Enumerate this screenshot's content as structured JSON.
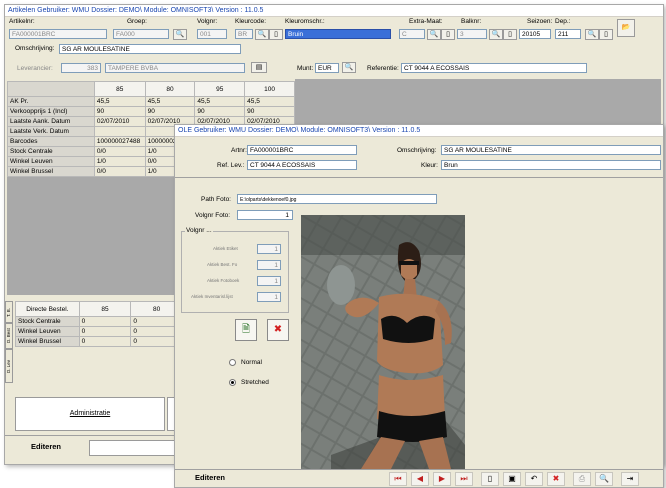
{
  "back": {
    "title": "Artikelen  Gebruiker: WMU  Dossier: DEMO\\  Module: OMNISOFT3\\  Version : 11.0.5",
    "labels": {
      "artikelnr": "Artikelnr:",
      "groep": "Groep:",
      "volgnr": "Volgnr:",
      "kleurcode": "Kleurcode:",
      "kleuromschr": "Kleuromschr.:",
      "extra_maat": "Extra-Maat:",
      "balknr": "Balknr:",
      "seizoen": "Seizoen:",
      "dep": "Dep.:",
      "omschrijving": "Omschrijving:",
      "leverancier": "Leverancier:",
      "munt": "Munt:",
      "referentie": "Referentie:"
    },
    "values": {
      "artikelnr": "FA000001BRC",
      "groep": "FA000",
      "volgnr": "001",
      "kleurcode": "BR",
      "kleuromschr": "Bruin",
      "extra_maat": "C",
      "balknr": "3",
      "seizoen": "20105",
      "dep": "211",
      "omschrijving": "SG AR MOULESATINE",
      "leverancier_code": "383",
      "leverancier_name": "TAMPERE BVBA",
      "munt": "EUR",
      "referentie": "CT 9044 A ECOSSAIS"
    },
    "grid": {
      "columns": [
        "85",
        "80",
        "95",
        "100"
      ],
      "rows": [
        {
          "label": "AK Pr.",
          "cells": [
            "45,5",
            "45,5",
            "45,5",
            "45,5"
          ]
        },
        {
          "label": "Verkoopprijs 1 (Incl)",
          "cells": [
            "90",
            "90",
            "90",
            "90"
          ]
        },
        {
          "label": "Laatste Aank. Datum",
          "cells": [
            "02/07/2010",
            "02/07/2010",
            "02/07/2010",
            "02/07/2010"
          ]
        },
        {
          "label": "Laatste Verk. Datum",
          "cells": [
            "",
            "",
            "",
            ""
          ]
        },
        {
          "label": "Barcodes",
          "cells": [
            "100000027488",
            "10000002",
            "",
            ""
          ]
        },
        {
          "label": "Stock Centrale",
          "cells": [
            "0/0",
            "1/0",
            "",
            ""
          ]
        },
        {
          "label": "Winkel Leuven",
          "cells": [
            "1/0",
            "0/0",
            "",
            ""
          ]
        },
        {
          "label": "Winkel Brussel",
          "cells": [
            "0/0",
            "1/0",
            "",
            ""
          ]
        }
      ]
    },
    "lower_grid": {
      "columns": [
        "Directe Bestel.",
        "85",
        "80"
      ],
      "rows": [
        {
          "label": "Stock Centrale",
          "cells": [
            "0",
            "0"
          ]
        },
        {
          "label": "Winkel Leuven",
          "cells": [
            "0",
            "0"
          ]
        },
        {
          "label": "Winkel Brussel",
          "cells": [
            "0",
            "0"
          ]
        }
      ]
    },
    "vtabs": [
      "T. B.",
      "D. Best",
      "D. Lev"
    ],
    "admin_button": "Administratie",
    "status": "Editeren"
  },
  "front": {
    "title": "OLE  Gebruiker: WMU  Dossier: DEMO\\  Module: OMNISOFT3\\  Version : 11.0.5",
    "labels": {
      "artnr": "Artnr:",
      "omschrijving": "Omschrijving:",
      "ref_lev": "Ref. Lev.:",
      "kleur": "Kleur:",
      "path_foto": "Path Foto:",
      "volgnr_foto": "Volgnr Foto:",
      "volgnr_group": "Volgnr ...",
      "aktiek_1": "Aktiek Etiket",
      "aktiek_2": "Aktiek Best. Fo",
      "aktiek_3": "Aktiek Fotoboek",
      "aktiek_4": "Aktiek Inventarisl.lijst",
      "normal": "Normal",
      "stretched": "Stretched"
    },
    "values": {
      "artnr": "FA000001BRC",
      "omschrijving": "SG AR MOULESATINE",
      "ref_lev": "CT 9044 A ECOSSAIS",
      "kleur": "Brun",
      "path_foto": "E:\\olparts\\dekkenoef0.jpg",
      "volgnr_foto": "1",
      "aktiek_1": "1",
      "aktiek_2": "1",
      "aktiek_3": "1",
      "aktiek_4": "1"
    },
    "status": "Editeren",
    "colors": {
      "photo_bg": "#5b5f5c",
      "skin": "#b07a56",
      "lingerie": "#111111",
      "delete_red": "#d32020"
    }
  }
}
